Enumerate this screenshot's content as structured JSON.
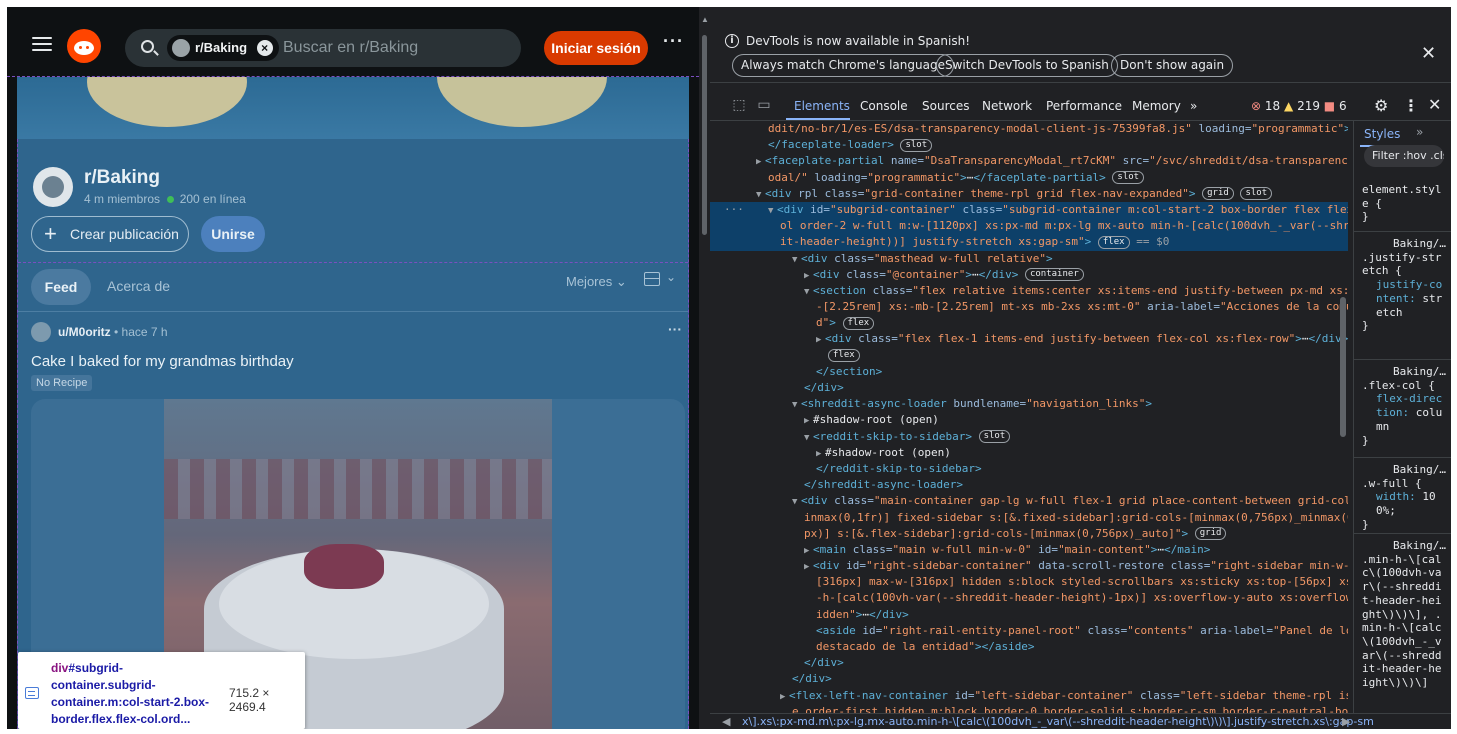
{
  "reddit": {
    "search_chip": "r/Baking",
    "search_placeholder": "Buscar en r/Baking",
    "login_button": "Iniciar sesión",
    "more": "···",
    "subreddit_name": "r/Baking",
    "members": "4 m miembros",
    "online": "200 en línea",
    "create_post": "Crear publicación",
    "join": "Unirse",
    "tab_feed": "Feed",
    "tab_about": "Acerca de",
    "sort": "Mejores ⌄",
    "view_chevron": "⌄",
    "post": {
      "user": "u/M0oritz",
      "time": " • hace 7 h",
      "title": "Cake I baked for my grandmas birthday",
      "flair": "No Recipe"
    }
  },
  "inspect_tooltip": {
    "tag": "div",
    "selector": "#subgrid-container.subgrid-container.m:col-start-2.box-border.flex.flex-col.ord...",
    "size": "715.2 × 2469.4"
  },
  "devtools": {
    "info_message": "DevTools is now available in Spanish!",
    "info_buttons": [
      "Always match Chrome's language",
      "Switch DevTools to Spanish",
      "Don't show again"
    ],
    "tabs": [
      "Elements",
      "Console",
      "Sources",
      "Network",
      "Performance",
      "Memory",
      "»"
    ],
    "errors": "18",
    "warnings": "219",
    "issues": "6",
    "breadcrumb": "x\\].xs\\:px-md.m\\:px-lg.mx-auto.min-h-\\[calc\\(100dvh_-_var\\(--shreddit-header-height\\)\\)\\].justify-stretch.xs\\:gap-sm",
    "styles_tab": "Styles",
    "styles_more": "»",
    "styles_filter": "Filter  :hov .cls",
    "styles_rules": [
      {
        "source": "",
        "selector": "element.style {",
        "decls": [],
        "close": "}"
      },
      {
        "source": "Baking/…",
        "selector": ".justify-stretch {",
        "decls": [
          [
            "justify-content",
            "stretch"
          ]
        ],
        "close": "}"
      },
      {
        "source": "Baking/…",
        "selector": ".flex-col {",
        "decls": [
          [
            "flex-direction",
            "column"
          ]
        ],
        "close": "}"
      },
      {
        "source": "Baking/…",
        "selector": ".w-full {",
        "decls": [
          [
            "width",
            "100%;"
          ]
        ],
        "close": "}"
      },
      {
        "source": "Baking/…",
        "selector": ".min-h-\\[calc\\(100dvh-var\\(--shreddit-header-height\\)\\)\\], .min-h-\\[calc\\(100dvh_-_var\\(--shreddit-header-height\\)\\)\\]",
        "decls": [],
        "close": ""
      }
    ],
    "dom_lines": [
      {
        "indent": 0,
        "tri": "",
        "sel": false,
        "parts": [
          [
            "av",
            "ddit/no-br/1/es-ES/dsa-transparency-modal-client-js-75399fa8.js\""
          ],
          [
            "an",
            " loading="
          ],
          [
            "av",
            "\"programmatic\""
          ],
          [
            "tg",
            ">"
          ]
        ],
        "badges": [],
        "ell": true
      },
      {
        "indent": 0,
        "tri": "",
        "sel": false,
        "parts": [
          [
            "tg",
            "</faceplate-loader>"
          ]
        ],
        "badges": [
          "slot"
        ]
      },
      {
        "indent": -1,
        "tri": "▶",
        "sel": false,
        "parts": [
          [
            "tg",
            "<faceplate-partial"
          ],
          [
            "an",
            " name="
          ],
          [
            "av",
            "\"DsaTransparencyModal_rt7cKM\""
          ],
          [
            "an",
            " src="
          ],
          [
            "av",
            "\"/svc/shreddit/dsa-transparency-m"
          ]
        ],
        "badges": []
      },
      {
        "indent": 0,
        "tri": "",
        "sel": false,
        "parts": [
          [
            "av",
            "odal/\""
          ],
          [
            "an",
            " loading="
          ],
          [
            "av",
            "\"programmatic\""
          ],
          [
            "tg",
            ">"
          ],
          [
            "tx",
            "⋯"
          ],
          [
            "tg",
            "</faceplate-partial>"
          ]
        ],
        "badges": [
          "slot"
        ]
      },
      {
        "indent": -1,
        "tri": "▼",
        "sel": false,
        "parts": [
          [
            "tg",
            "<div"
          ],
          [
            "an",
            " rpl class="
          ],
          [
            "av",
            "\"grid-container theme-rpl grid flex-nav-expanded\""
          ],
          [
            "tg",
            ">"
          ]
        ],
        "badges": [
          "grid",
          "slot"
        ]
      },
      {
        "indent": 0,
        "tri": "▼",
        "sel": true,
        "parts": [
          [
            "tg",
            "<div"
          ],
          [
            "an",
            " id="
          ],
          [
            "av",
            "\"subgrid-container\""
          ],
          [
            "an",
            " class="
          ],
          [
            "av",
            "\"subgrid-container m:col-start-2 box-border flex flex-c"
          ]
        ],
        "badges": []
      },
      {
        "indent": 1,
        "tri": "",
        "sel": true,
        "parts": [
          [
            "av",
            "ol order-2 w-full m:w-[1120px] xs:px-md m:px-lg mx-auto min-h-[calc(100dvh_-_var(--shredd"
          ]
        ],
        "badges": []
      },
      {
        "indent": 1,
        "tri": "",
        "sel": true,
        "parts": [
          [
            "av",
            "it-header-height))] justify-stretch xs:gap-sm\""
          ],
          [
            "tg",
            ">"
          ]
        ],
        "badges": [
          "flex"
        ],
        "tail": " == $0"
      },
      {
        "indent": 2,
        "tri": "▼",
        "sel": false,
        "parts": [
          [
            "tg",
            "<div"
          ],
          [
            "an",
            " class="
          ],
          [
            "av",
            "\"masthead w-full relative\""
          ],
          [
            "tg",
            ">"
          ]
        ],
        "badges": []
      },
      {
        "indent": 3,
        "tri": "▶",
        "sel": false,
        "parts": [
          [
            "tg",
            "<div"
          ],
          [
            "an",
            " class="
          ],
          [
            "av",
            "\"@container\""
          ],
          [
            "tg",
            ">"
          ],
          [
            "tx",
            "⋯"
          ],
          [
            "tg",
            "</div>"
          ]
        ],
        "badges": [
          "container"
        ]
      },
      {
        "indent": 3,
        "tri": "▼",
        "sel": false,
        "parts": [
          [
            "tg",
            "<section"
          ],
          [
            "an",
            " class="
          ],
          [
            "av",
            "\"flex relative items:center xs:items-end justify-between px-md xs:-top"
          ]
        ],
        "badges": []
      },
      {
        "indent": 4,
        "tri": "",
        "sel": false,
        "parts": [
          [
            "av",
            "-[2.25rem] xs:-mb-[2.25rem] mt-xs mb-2xs xs:mt-0\""
          ],
          [
            "an",
            " aria-label="
          ],
          [
            "av",
            "\"Acciones de la comunida"
          ]
        ],
        "badges": []
      },
      {
        "indent": 4,
        "tri": "",
        "sel": false,
        "parts": [
          [
            "av",
            "d\""
          ],
          [
            "tg",
            ">"
          ]
        ],
        "badges": [
          "flex"
        ]
      },
      {
        "indent": 4,
        "tri": "▶",
        "sel": false,
        "parts": [
          [
            "tg",
            "<div"
          ],
          [
            "an",
            " class="
          ],
          [
            "av",
            "\"flex flex-1 items-end justify-between flex-col xs:flex-row\""
          ],
          [
            "tg",
            ">"
          ],
          [
            "tx",
            "⋯"
          ],
          [
            "tg",
            "</div>"
          ]
        ],
        "badges": []
      },
      {
        "indent": 5,
        "tri": "",
        "sel": false,
        "parts": [],
        "badges": [
          "flex"
        ]
      },
      {
        "indent": 4,
        "tri": "",
        "sel": false,
        "parts": [
          [
            "tg",
            "</section>"
          ]
        ],
        "badges": []
      },
      {
        "indent": 3,
        "tri": "",
        "sel": false,
        "parts": [
          [
            "tg",
            "</div>"
          ]
        ],
        "badges": []
      },
      {
        "indent": 2,
        "tri": "▼",
        "sel": false,
        "parts": [
          [
            "tg",
            "<shreddit-async-loader"
          ],
          [
            "an",
            " bundlename="
          ],
          [
            "av",
            "\"navigation_links\""
          ],
          [
            "tg",
            ">"
          ]
        ],
        "badges": []
      },
      {
        "indent": 3,
        "tri": "▶",
        "sel": false,
        "parts": [
          [
            "tx",
            "#shadow-root (open)"
          ]
        ],
        "badges": []
      },
      {
        "indent": 3,
        "tri": "▼",
        "sel": false,
        "parts": [
          [
            "tg",
            "<reddit-skip-to-sidebar>"
          ]
        ],
        "badges": [
          "slot"
        ]
      },
      {
        "indent": 4,
        "tri": "▶",
        "sel": false,
        "parts": [
          [
            "tx",
            "#shadow-root (open)"
          ]
        ],
        "badges": []
      },
      {
        "indent": 4,
        "tri": "",
        "sel": false,
        "parts": [
          [
            "tg",
            "</reddit-skip-to-sidebar>"
          ]
        ],
        "badges": []
      },
      {
        "indent": 3,
        "tri": "",
        "sel": false,
        "parts": [
          [
            "tg",
            "</shreddit-async-loader>"
          ]
        ],
        "badges": []
      },
      {
        "indent": 2,
        "tri": "▼",
        "sel": false,
        "parts": [
          [
            "tg",
            "<div"
          ],
          [
            "an",
            " class="
          ],
          [
            "av",
            "\"main-container gap-lg w-full flex-1 grid place-content-between grid-cols-[m"
          ]
        ],
        "badges": []
      },
      {
        "indent": 3,
        "tri": "",
        "sel": false,
        "parts": [
          [
            "av",
            "inmax(0,1fr)] fixed-sidebar s:[&.fixed-sidebar]:grid-cols-[minmax(0,756px)_minmax(0,316"
          ]
        ],
        "badges": []
      },
      {
        "indent": 3,
        "tri": "",
        "sel": false,
        "parts": [
          [
            "av",
            "px)] s:[&.flex-sidebar]:grid-cols-[minmax(0,756px)_auto]\""
          ],
          [
            "tg",
            ">"
          ]
        ],
        "badges": [
          "grid"
        ]
      },
      {
        "indent": 3,
        "tri": "▶",
        "sel": false,
        "parts": [
          [
            "tg",
            "<main"
          ],
          [
            "an",
            " class="
          ],
          [
            "av",
            "\"main w-full min-w-0\""
          ],
          [
            "an",
            " id="
          ],
          [
            "av",
            "\"main-content\""
          ],
          [
            "tg",
            ">"
          ],
          [
            "tx",
            "⋯"
          ],
          [
            "tg",
            "</main>"
          ]
        ],
        "badges": []
      },
      {
        "indent": 3,
        "tri": "▶",
        "sel": false,
        "parts": [
          [
            "tg",
            "<div"
          ],
          [
            "an",
            " id="
          ],
          [
            "av",
            "\"right-sidebar-container\""
          ],
          [
            "an",
            " data-scroll-restore class="
          ],
          [
            "av",
            "\"right-sidebar min-w-0 w-"
          ]
        ],
        "badges": []
      },
      {
        "indent": 4,
        "tri": "",
        "sel": false,
        "parts": [
          [
            "av",
            "[316px] max-w-[316px] hidden s:block styled-scrollbars xs:sticky xs:top-[56px] xs:max"
          ]
        ],
        "badges": []
      },
      {
        "indent": 4,
        "tri": "",
        "sel": false,
        "parts": [
          [
            "av",
            "-h-[calc(100vh-var(--shreddit-header-height)-1px)] xs:overflow-y-auto xs:overflow-x-h"
          ]
        ],
        "badges": []
      },
      {
        "indent": 4,
        "tri": "",
        "sel": false,
        "parts": [
          [
            "av",
            "idden\""
          ],
          [
            "tg",
            ">"
          ],
          [
            "tx",
            "⋯"
          ],
          [
            "tg",
            "</div>"
          ]
        ],
        "badges": []
      },
      {
        "indent": 4,
        "tri": "",
        "sel": false,
        "parts": [
          [
            "tg",
            "<aside"
          ],
          [
            "an",
            " id="
          ],
          [
            "av",
            "\"right-rail-entity-panel-root\""
          ],
          [
            "an",
            " class="
          ],
          [
            "av",
            "\"contents\""
          ],
          [
            "an",
            " aria-label="
          ],
          [
            "av",
            "\"Panel de lo más"
          ]
        ],
        "badges": []
      },
      {
        "indent": 4,
        "tri": "",
        "sel": false,
        "parts": [
          [
            "av",
            "destacado de la entidad\""
          ],
          [
            "tg",
            "></aside>"
          ]
        ],
        "badges": []
      },
      {
        "indent": 3,
        "tri": "",
        "sel": false,
        "parts": [
          [
            "tg",
            "</div>"
          ]
        ],
        "badges": []
      },
      {
        "indent": 2,
        "tri": "",
        "sel": false,
        "parts": [
          [
            "tg",
            "</div>"
          ]
        ],
        "badges": []
      },
      {
        "indent": 1,
        "tri": "▶",
        "sel": false,
        "parts": [
          [
            "tg",
            "<flex-left-nav-container"
          ],
          [
            "an",
            " id="
          ],
          [
            "av",
            "\"left-sidebar-container\""
          ],
          [
            "an",
            " class="
          ],
          [
            "av",
            "\"left-sidebar theme-rpl isolat"
          ]
        ],
        "badges": []
      },
      {
        "indent": 2,
        "tri": "",
        "sel": false,
        "parts": [
          [
            "av",
            "e order-first hidden m:block border-0 border-solid s:border-r-sm border-r-neutral-border\""
          ]
        ],
        "badges": []
      }
    ]
  }
}
